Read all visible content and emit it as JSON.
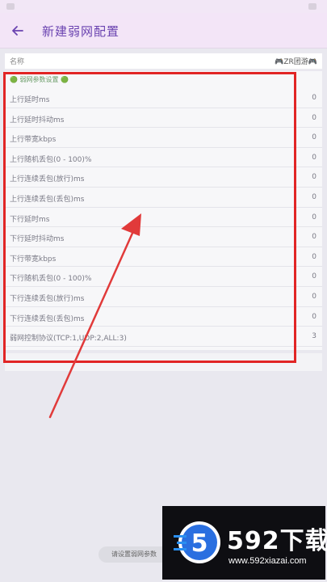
{
  "app_bar": {
    "title": "新建弱网配置"
  },
  "name_row": {
    "label": "名称",
    "value": "🎮ZR团游🎮"
  },
  "settings": {
    "group_header": "🟢 弱网参数设置 🟢",
    "rows": [
      {
        "label": "上行延时ms",
        "value": "0"
      },
      {
        "label": "上行延时抖动ms",
        "value": "0"
      },
      {
        "label": "上行带宽kbps",
        "value": "0"
      },
      {
        "label": "上行随机丢包(0 - 100)%",
        "value": "0"
      },
      {
        "label": "上行连续丢包(放行)ms",
        "value": "0"
      },
      {
        "label": "上行连续丢包(丢包)ms",
        "value": "0"
      },
      {
        "label": "下行延时ms",
        "value": "0"
      },
      {
        "label": "下行延时抖动ms",
        "value": "0"
      },
      {
        "label": "下行带宽kbps",
        "value": "0"
      },
      {
        "label": "下行随机丢包(0 - 100)%",
        "value": "0"
      },
      {
        "label": "下行连续丢包(放行)ms",
        "value": "0"
      },
      {
        "label": "下行连续丢包(丢包)ms",
        "value": "0"
      },
      {
        "label": "弱网控制协议(TCP:1,UDP:2,ALL:3)",
        "value": "3"
      }
    ]
  },
  "toast": {
    "text": "请设置弱网参数"
  },
  "watermark": {
    "logo_text": "5",
    "brand": "592下载",
    "url": "www.592xiazai.com"
  },
  "colors": {
    "app_bar_bg": "#f3e5f7",
    "accent": "#6a43b0",
    "highlight": "#e12525"
  }
}
